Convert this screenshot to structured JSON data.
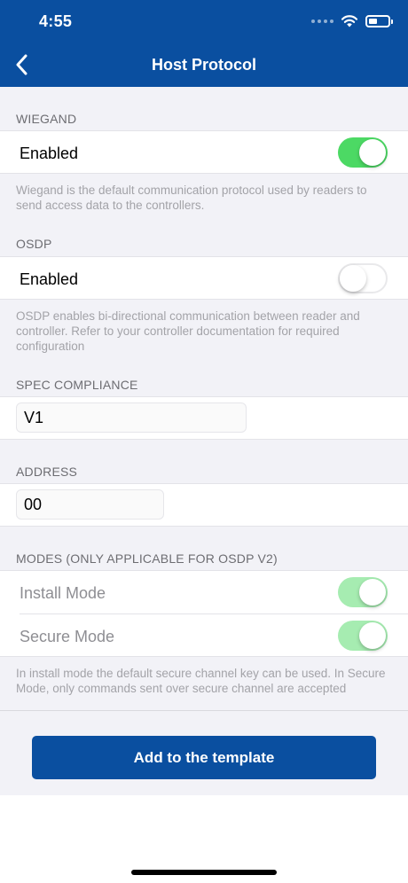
{
  "status_bar": {
    "time": "4:55"
  },
  "nav": {
    "title": "Host Protocol"
  },
  "wiegand": {
    "header": "WIEGAND",
    "enabled_label": "Enabled",
    "enabled": true,
    "footer": "Wiegand is the default communication protocol used by readers to send access data to the controllers."
  },
  "osdp": {
    "header": "OSDP",
    "enabled_label": "Enabled",
    "enabled": false,
    "footer": "OSDP enables bi-directional communication between reader and controller. Refer to your controller documentation for required configuration"
  },
  "spec_compliance": {
    "header": "SPEC COMPLIANCE",
    "value": "V1"
  },
  "address": {
    "header": "ADDRESS",
    "value": "00"
  },
  "modes": {
    "header": "MODES (ONLY APPLICABLE FOR OSDP V2)",
    "items": [
      {
        "label": "Install Mode",
        "enabled": true
      },
      {
        "label": "Secure Mode",
        "enabled": true
      }
    ],
    "footer": "In install mode the default secure channel key can be used. In Secure Mode, only commands sent over secure channel are accepted"
  },
  "actions": {
    "add_button_label": "Add to the template"
  },
  "colors": {
    "brand": "#0a4fa0",
    "toggle_on": "#4cd964",
    "toggle_on_disabled": "#a6ecb1",
    "group_bg": "#f2f2f7"
  }
}
